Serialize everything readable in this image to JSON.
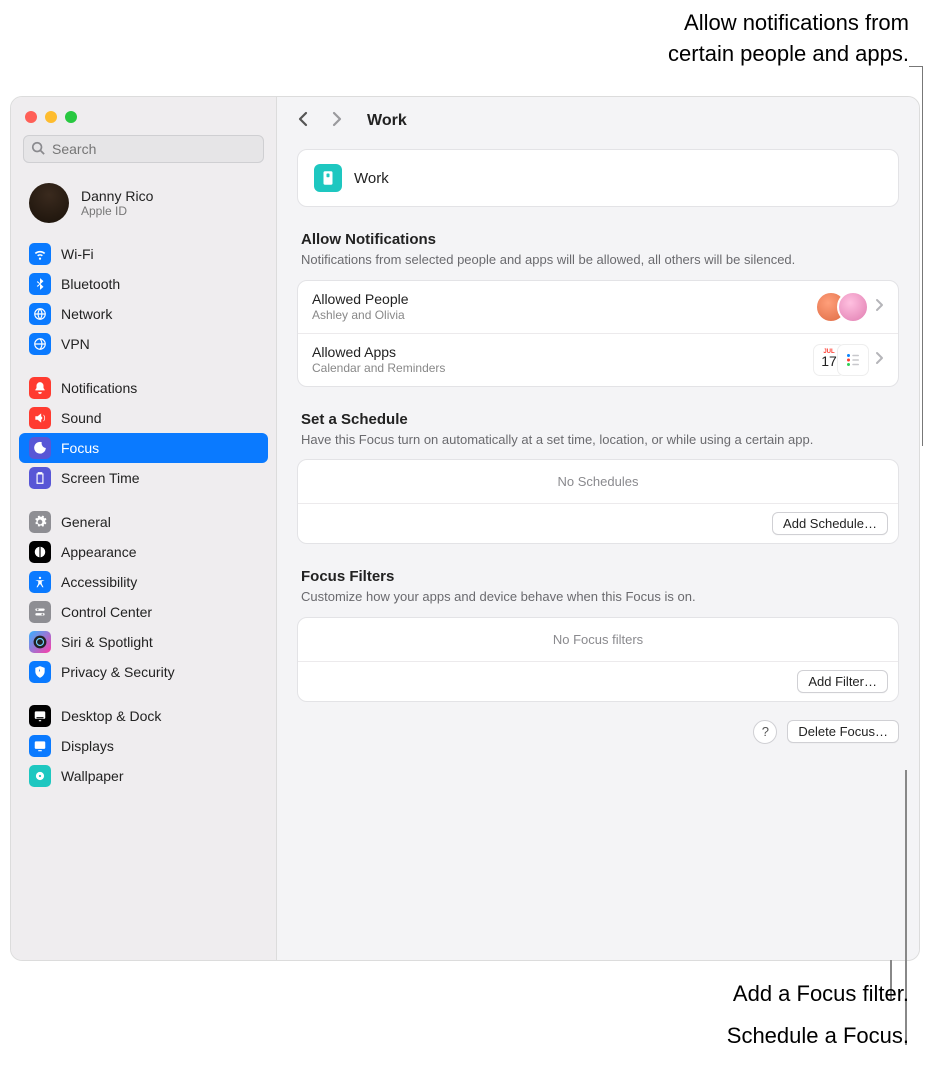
{
  "annotations": {
    "top": "Allow notifications from\ncertain people and apps.",
    "filter": "Add a Focus filter.",
    "schedule": "Schedule a Focus."
  },
  "search": {
    "placeholder": "Search"
  },
  "account": {
    "name": "Danny Rico",
    "sub": "Apple ID"
  },
  "sidebar": {
    "groups": [
      [
        {
          "label": "Wi-Fi",
          "bg": "#0a7aff"
        },
        {
          "label": "Bluetooth",
          "bg": "#0a7aff"
        },
        {
          "label": "Network",
          "bg": "#0a7aff"
        },
        {
          "label": "VPN",
          "bg": "#0a7aff"
        }
      ],
      [
        {
          "label": "Notifications",
          "bg": "#ff3b30"
        },
        {
          "label": "Sound",
          "bg": "#ff3b30"
        },
        {
          "label": "Focus",
          "bg": "#5856d6",
          "selected": true
        },
        {
          "label": "Screen Time",
          "bg": "#5856d6"
        }
      ],
      [
        {
          "label": "General",
          "bg": "#8e8e93"
        },
        {
          "label": "Appearance",
          "bg": "#000"
        },
        {
          "label": "Accessibility",
          "bg": "#0a7aff"
        },
        {
          "label": "Control Center",
          "bg": "#8e8e93"
        },
        {
          "label": "Siri & Spotlight",
          "bg": "linear-gradient(135deg,#38b1ff,#ff3aa7)"
        },
        {
          "label": "Privacy & Security",
          "bg": "#0a7aff"
        }
      ],
      [
        {
          "label": "Desktop & Dock",
          "bg": "#000"
        },
        {
          "label": "Displays",
          "bg": "#0a7aff"
        },
        {
          "label": "Wallpaper",
          "bg": "#1ec7c0"
        }
      ]
    ]
  },
  "header": {
    "title": "Work"
  },
  "focus": {
    "name": "Work"
  },
  "allow": {
    "title": "Allow Notifications",
    "desc": "Notifications from selected people and apps will be allowed, all others will be silenced.",
    "people": {
      "title": "Allowed People",
      "sub": "Ashley and Olivia"
    },
    "apps": {
      "title": "Allowed Apps",
      "sub": "Calendar and Reminders"
    }
  },
  "schedule": {
    "title": "Set a Schedule",
    "desc": "Have this Focus turn on automatically at a set time, location, or while using a certain app.",
    "empty": "No Schedules",
    "button": "Add Schedule…"
  },
  "filters": {
    "title": "Focus Filters",
    "desc": "Customize how your apps and device behave when this Focus is on.",
    "empty": "No Focus filters",
    "button": "Add Filter…"
  },
  "footer": {
    "help": "?",
    "delete": "Delete Focus…"
  },
  "icons": {
    "calendar_day": "17",
    "calendar_month": "JUL"
  }
}
